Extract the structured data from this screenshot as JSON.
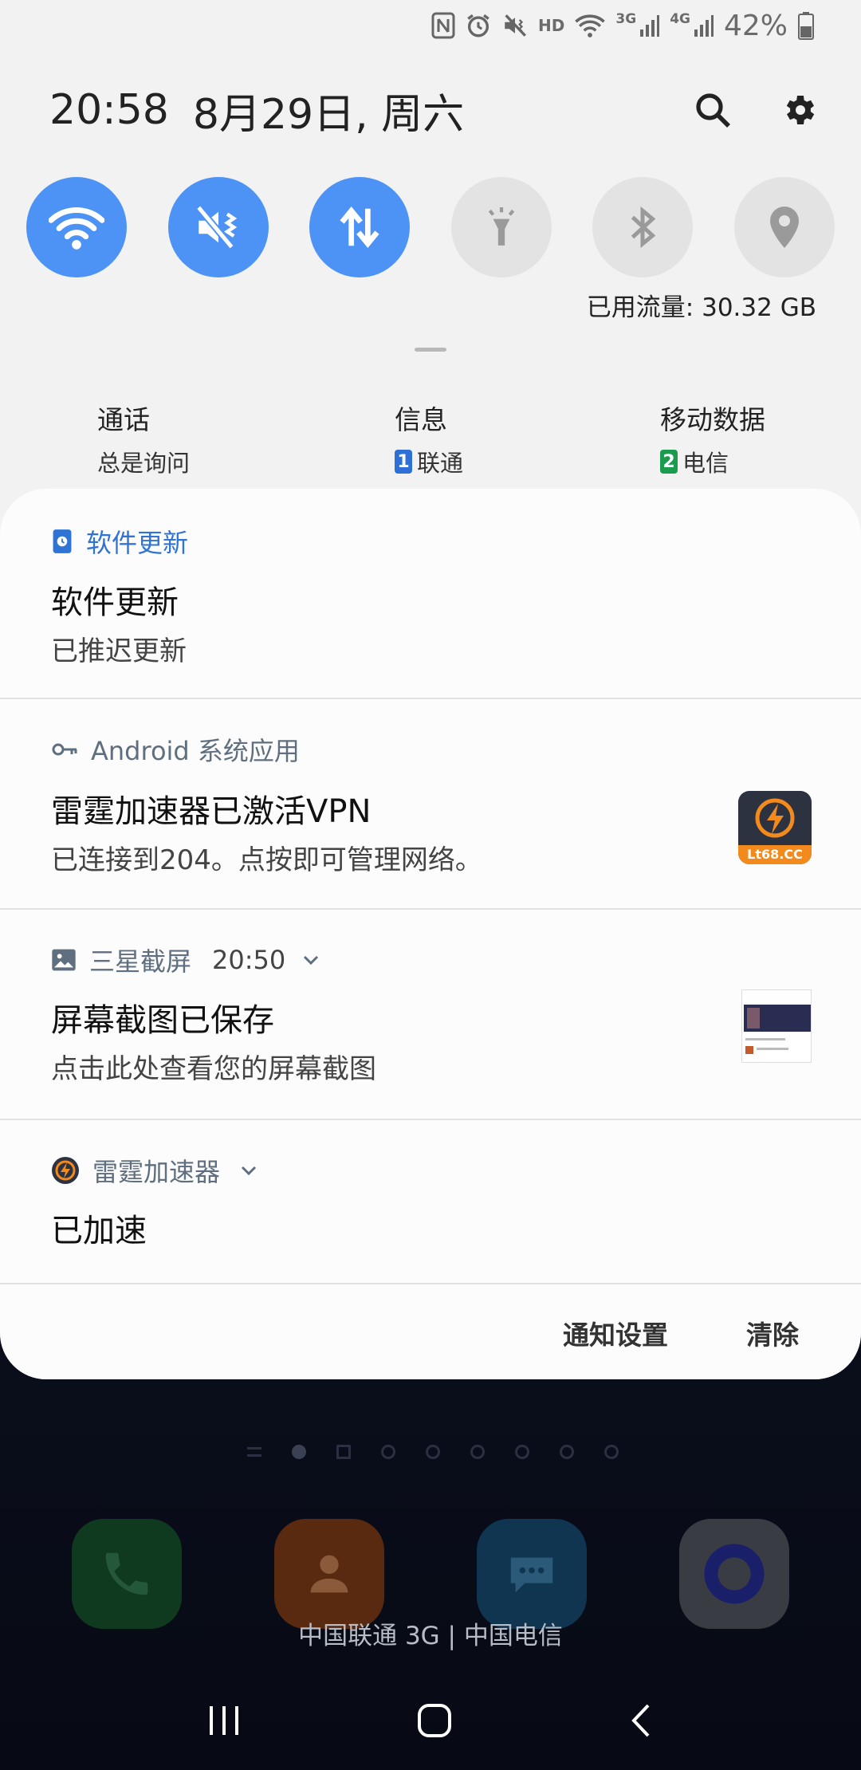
{
  "status_bar": {
    "hd_label": "HD",
    "net_3g": "3G",
    "net_4g": "4G",
    "battery": "42%"
  },
  "header": {
    "time": "20:58",
    "date": "8月29日, 周六"
  },
  "quick_toggles": [
    {
      "name": "wifi",
      "state": "on"
    },
    {
      "name": "sound",
      "state": "on"
    },
    {
      "name": "mobile-data",
      "state": "on"
    },
    {
      "name": "flashlight",
      "state": "off"
    },
    {
      "name": "bluetooth",
      "state": "off"
    },
    {
      "name": "location",
      "state": "off"
    }
  ],
  "data_usage": "已用流量: 30.32 GB",
  "sim": {
    "call": {
      "title": "通话",
      "value": "总是询问"
    },
    "message": {
      "title": "信息",
      "badge": "1",
      "value": "联通"
    },
    "mobile_data": {
      "title": "移动数据",
      "badge": "2",
      "value": "电信"
    }
  },
  "notifications": {
    "software_update": {
      "app": "软件更新",
      "title": "软件更新",
      "text": "已推迟更新"
    },
    "vpn": {
      "app": "Android 系统应用",
      "title": "雷霆加速器已激活VPN",
      "text": "已连接到204。点按即可管理网络。",
      "icon_label": "Lt68.CC"
    },
    "screenshot": {
      "app": "三星截屏",
      "time": "20:50",
      "title": "屏幕截图已保存",
      "text": "点击此处查看您的屏幕截图"
    },
    "accelerator": {
      "app": "雷霆加速器",
      "title": "已加速"
    }
  },
  "actions": {
    "settings": "通知设置",
    "clear": "清除"
  },
  "home": {
    "carrier": "中国联通 3G | 中国电信"
  },
  "colors": {
    "accent_blue": "#4d93f5",
    "app_name_blue": "#2f73d4",
    "shade_bg": "#f2f2f2"
  }
}
